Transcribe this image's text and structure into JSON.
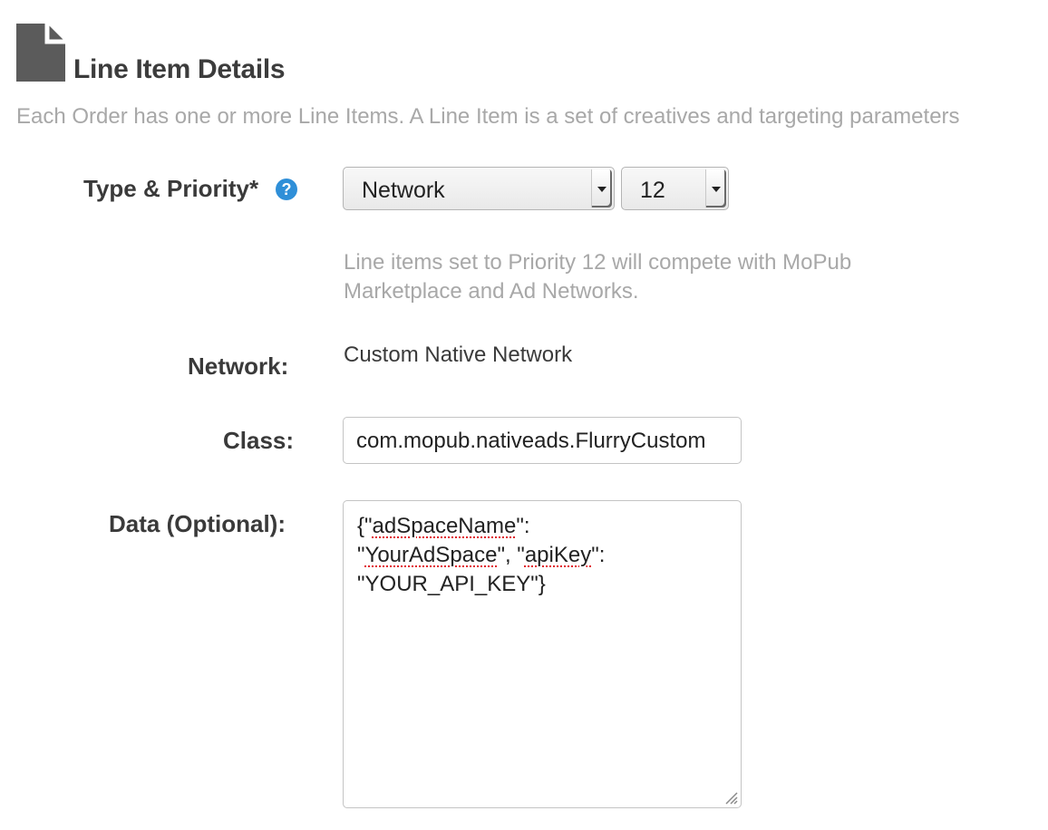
{
  "header": {
    "icon": "document-icon",
    "title": "Line Item Details",
    "intro": "Each Order has one or more Line Items. A Line Item is a set of creatives and targeting parameters"
  },
  "form": {
    "type_priority": {
      "label": "Type & Priority*",
      "help_icon": "question-circle-icon",
      "help_glyph": "?",
      "type_value": "Network",
      "priority_value": "12",
      "hint_line1": "Line items set to Priority 12 will compete with MoPub",
      "hint_line2": "Marketplace and Ad Networks."
    },
    "network": {
      "label": "Network:",
      "value": "Custom Native Network"
    },
    "class": {
      "label": "Class:",
      "value": "com.mopub.nativeads.FlurryCustom"
    },
    "data": {
      "label": "Data (Optional):",
      "line1_a": "{\"",
      "line1_b": "adSpaceName",
      "line1_c": "\":",
      "line2_a": "\"",
      "line2_b": "YourAdSpace",
      "line2_c": "\", \"",
      "line2_d": "apiKey",
      "line2_e": "\":",
      "line3": "\"YOUR_API_KEY\"}"
    }
  },
  "colors": {
    "accent": "#2f8fd8",
    "muted_text": "#a8a8a8",
    "spellcheck": "#e0202a"
  }
}
